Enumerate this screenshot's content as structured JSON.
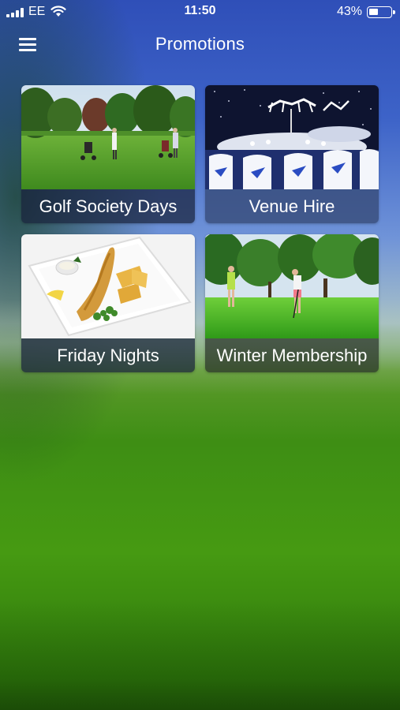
{
  "status_bar": {
    "carrier": "EE",
    "time": "11:50",
    "battery_percent": "43%",
    "battery_level": 0.43,
    "icons": [
      "signal-icon",
      "wifi-icon",
      "battery-icon"
    ]
  },
  "header": {
    "title": "Promotions",
    "menu_icon": "hamburger-menu-icon"
  },
  "promotions": [
    {
      "label": "Golf Society Days",
      "image": "golfers-on-course-photo"
    },
    {
      "label": "Venue Hire",
      "image": "banquet-hall-photo"
    },
    {
      "label": "Friday Nights",
      "image": "fish-and-chips-photo"
    },
    {
      "label": "Winter Membership",
      "image": "lady-golfers-putting-photo"
    }
  ],
  "colors": {
    "header_sky": "#2f4fb8",
    "grass": "#3e8e14",
    "caption_bg": "#19233c",
    "text": "#ffffff"
  }
}
